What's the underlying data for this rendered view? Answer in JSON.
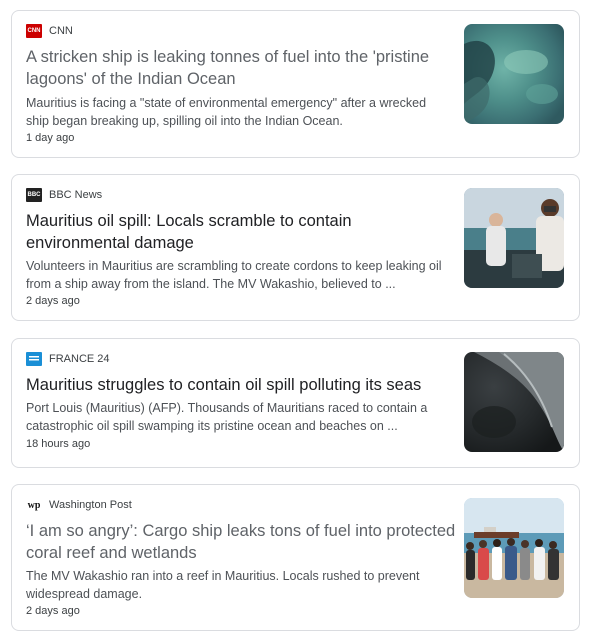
{
  "articles": [
    {
      "source": "CNN",
      "title": "A stricken ship is leaking tonnes of fuel into the 'pristine lagoons' of the Indian Ocean",
      "snippet": "Mauritius is facing a \"state of environmental emergency\" after a wrecked ship began breaking up, spilling oil into the Indian Ocean.",
      "time": "1 day ago"
    },
    {
      "source": "BBC News",
      "title": "Mauritius oil spill: Locals scramble to contain environmental damage",
      "snippet": "Volunteers in Mauritius are scrambling to create cordons to keep leaking oil from a ship away from the island. The MV Wakashio, believed to ...",
      "time": "2 days ago"
    },
    {
      "source": "FRANCE 24",
      "title": "Mauritius struggles to contain oil spill polluting its seas",
      "snippet": "Port Louis (Mauritius) (AFP). Thousands of Mauritians raced to contain a catastrophic oil spill swamping its pristine ocean and beaches on ...",
      "time": "18 hours ago"
    },
    {
      "source": "Washington Post",
      "title": "‘I am so angry’: Cargo ship leaks tons of fuel into protected coral reef and wetlands",
      "snippet": "The MV Wakashio ran into a reef in Mauritius. Locals rushed to prevent widespread damage.",
      "time": "2 days ago"
    }
  ],
  "logos": {
    "cnn": "CNN",
    "bbc": "BBC",
    "wp": "wp"
  },
  "colors": {
    "cnn_red": "#cc0000",
    "france24_blue": "#1a8fd6"
  },
  "icons": [
    "cnn-logo-icon",
    "bbc-logo-icon",
    "france24-logo-icon",
    "washington-post-logo-icon"
  ]
}
